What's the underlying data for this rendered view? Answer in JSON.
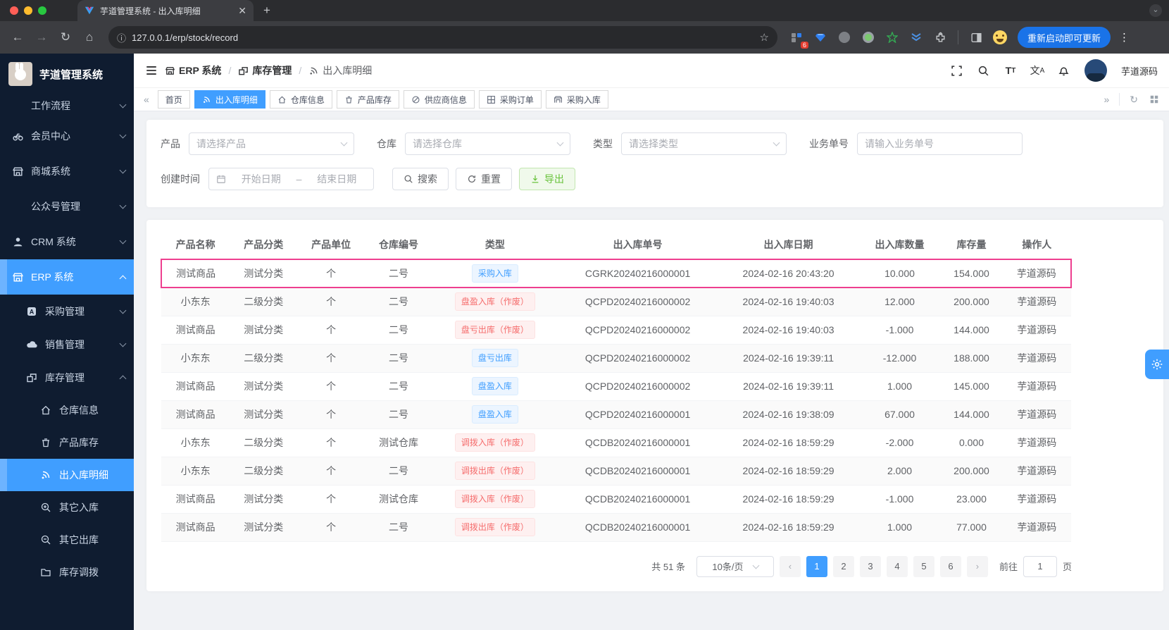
{
  "browser": {
    "tab_title": "芋道管理系统 - 出入库明细",
    "url": "127.0.0.1/erp/stock/record",
    "extension_badge": "6",
    "update_button": "重新启动即可更新"
  },
  "sidebar": {
    "app_title": "芋道管理系统",
    "items": [
      {
        "label": "工作流程"
      },
      {
        "label": "会员中心"
      },
      {
        "label": "商城系统"
      },
      {
        "label": "公众号管理"
      },
      {
        "label": "CRM 系统"
      },
      {
        "label": "ERP 系统"
      },
      {
        "label": "采购管理"
      },
      {
        "label": "销售管理"
      },
      {
        "label": "库存管理"
      },
      {
        "label": "仓库信息"
      },
      {
        "label": "产品库存"
      },
      {
        "label": "出入库明细"
      },
      {
        "label": "其它入库"
      },
      {
        "label": "其它出库"
      },
      {
        "label": "库存调拨"
      }
    ]
  },
  "header": {
    "breadcrumb": [
      {
        "label": "ERP 系统"
      },
      {
        "label": "库存管理"
      },
      {
        "label": "出入库明细"
      }
    ],
    "username": "芋道源码"
  },
  "tabs": [
    {
      "label": "首页"
    },
    {
      "label": "出入库明细"
    },
    {
      "label": "仓库信息"
    },
    {
      "label": "产品库存"
    },
    {
      "label": "供应商信息"
    },
    {
      "label": "采购订单"
    },
    {
      "label": "采购入库"
    }
  ],
  "filters": {
    "product_label": "产品",
    "product_placeholder": "请选择产品",
    "warehouse_label": "仓库",
    "warehouse_placeholder": "请选择仓库",
    "type_label": "类型",
    "type_placeholder": "请选择类型",
    "bizno_label": "业务单号",
    "bizno_placeholder": "请输入业务单号",
    "created_label": "创建时间",
    "date_start_placeholder": "开始日期",
    "date_separator": "–",
    "date_end_placeholder": "结束日期",
    "search_button": "搜索",
    "reset_button": "重置",
    "export_button": "导出"
  },
  "table": {
    "columns": [
      "产品名称",
      "产品分类",
      "产品单位",
      "仓库编号",
      "类型",
      "出入库单号",
      "出入库日期",
      "出入库数量",
      "库存量",
      "操作人"
    ],
    "rows": [
      {
        "product": "测试商品",
        "category": "测试分类",
        "unit": "个",
        "warehouse": "二号",
        "type": "采购入库",
        "type_variant": "blue",
        "order_no": "CGRK20240216000001",
        "date": "2024-02-16 20:43:20",
        "qty": "10.000",
        "stock": "154.000",
        "operator": "芋道源码",
        "highlight": true
      },
      {
        "product": "小东东",
        "category": "二级分类",
        "unit": "个",
        "warehouse": "二号",
        "type": "盘盈入库（作废）",
        "type_variant": "red",
        "order_no": "QCPD20240216000002",
        "date": "2024-02-16 19:40:03",
        "qty": "12.000",
        "stock": "200.000",
        "operator": "芋道源码"
      },
      {
        "product": "测试商品",
        "category": "测试分类",
        "unit": "个",
        "warehouse": "二号",
        "type": "盘亏出库（作废）",
        "type_variant": "red",
        "order_no": "QCPD20240216000002",
        "date": "2024-02-16 19:40:03",
        "qty": "-1.000",
        "stock": "144.000",
        "operator": "芋道源码"
      },
      {
        "product": "小东东",
        "category": "二级分类",
        "unit": "个",
        "warehouse": "二号",
        "type": "盘亏出库",
        "type_variant": "blue",
        "order_no": "QCPD20240216000002",
        "date": "2024-02-16 19:39:11",
        "qty": "-12.000",
        "stock": "188.000",
        "operator": "芋道源码"
      },
      {
        "product": "测试商品",
        "category": "测试分类",
        "unit": "个",
        "warehouse": "二号",
        "type": "盘盈入库",
        "type_variant": "blue",
        "order_no": "QCPD20240216000002",
        "date": "2024-02-16 19:39:11",
        "qty": "1.000",
        "stock": "145.000",
        "operator": "芋道源码"
      },
      {
        "product": "测试商品",
        "category": "测试分类",
        "unit": "个",
        "warehouse": "二号",
        "type": "盘盈入库",
        "type_variant": "blue",
        "order_no": "QCPD20240216000001",
        "date": "2024-02-16 19:38:09",
        "qty": "67.000",
        "stock": "144.000",
        "operator": "芋道源码"
      },
      {
        "product": "小东东",
        "category": "二级分类",
        "unit": "个",
        "warehouse": "测试仓库",
        "type": "调拨入库（作废）",
        "type_variant": "red",
        "order_no": "QCDB20240216000001",
        "date": "2024-02-16 18:59:29",
        "qty": "-2.000",
        "stock": "0.000",
        "operator": "芋道源码"
      },
      {
        "product": "小东东",
        "category": "二级分类",
        "unit": "个",
        "warehouse": "二号",
        "type": "调拨出库（作废）",
        "type_variant": "red",
        "order_no": "QCDB20240216000001",
        "date": "2024-02-16 18:59:29",
        "qty": "2.000",
        "stock": "200.000",
        "operator": "芋道源码"
      },
      {
        "product": "测试商品",
        "category": "测试分类",
        "unit": "个",
        "warehouse": "测试仓库",
        "type": "调拨入库（作废）",
        "type_variant": "red",
        "order_no": "QCDB20240216000001",
        "date": "2024-02-16 18:59:29",
        "qty": "-1.000",
        "stock": "23.000",
        "operator": "芋道源码"
      },
      {
        "product": "测试商品",
        "category": "测试分类",
        "unit": "个",
        "warehouse": "二号",
        "type": "调拨出库（作废）",
        "type_variant": "red",
        "order_no": "QCDB20240216000001",
        "date": "2024-02-16 18:59:29",
        "qty": "1.000",
        "stock": "77.000",
        "operator": "芋道源码"
      }
    ]
  },
  "pagination": {
    "total_text": "共 51 条",
    "page_size": "10条/页",
    "pages": [
      "1",
      "2",
      "3",
      "4",
      "5",
      "6"
    ],
    "active_page": "1",
    "goto_label": "前往",
    "goto_value": "1",
    "page_suffix": "页"
  }
}
